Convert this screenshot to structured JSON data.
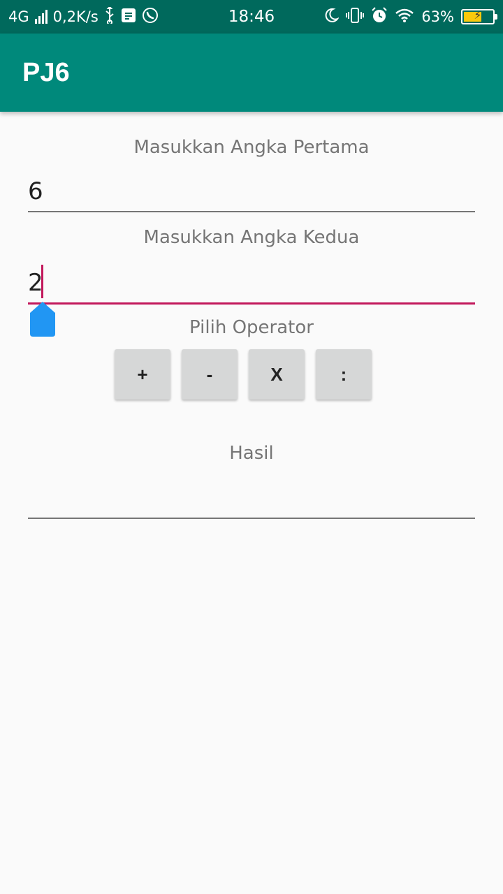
{
  "status_bar": {
    "network": "4G",
    "speed": "0,2K/s",
    "time": "18:46",
    "battery_percent": "63%",
    "battery_level": 0.63,
    "icons": [
      "usb-icon",
      "whatsapp-icon",
      "moon-icon",
      "vibrate-icon",
      "alarm-icon",
      "wifi-icon"
    ]
  },
  "app_bar": {
    "title": "PJ6"
  },
  "form": {
    "first_label": "Masukkan Angka Pertama",
    "first_value": "6",
    "second_label": "Masukkan Angka Kedua",
    "second_value": "2",
    "operator_label": "Pilih Operator",
    "operators": [
      "+",
      "-",
      "X",
      ":"
    ],
    "result_label": "Hasil",
    "result_value": ""
  },
  "colors": {
    "status_bar": "#00695c",
    "app_bar": "#00897b",
    "accent": "#c2185b",
    "handle": "#2196f3",
    "button": "#d6d7d7"
  }
}
